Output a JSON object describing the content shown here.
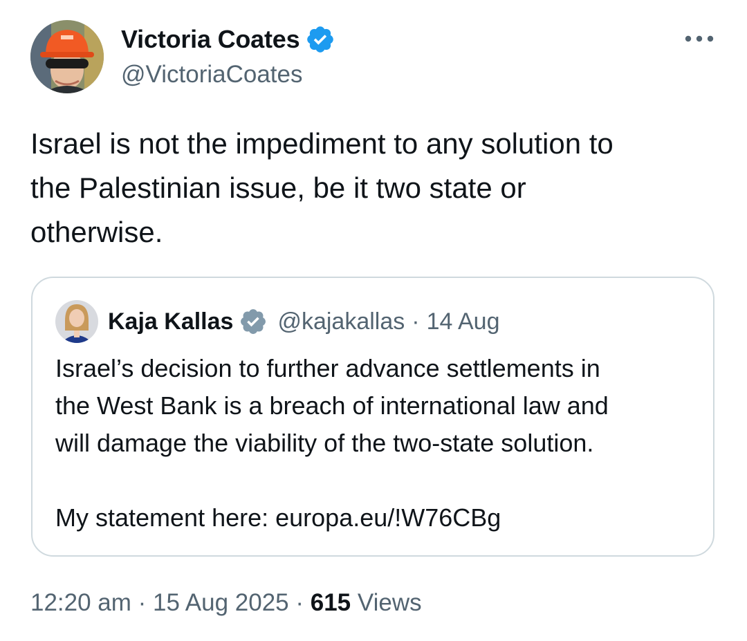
{
  "author": {
    "name": "Victoria Coates",
    "handle": "@VictoriaCoates",
    "avatar_icon": "hardhat-person-avatar",
    "verified_icon": "blue-verified-badge-icon",
    "verified_color": "#1d9bf0"
  },
  "more_icon": "more-horizontal-icon",
  "tweet_text": "Israel is not the impediment to any solution to\nthe Palestinian issue, be it two state or\notherwise.",
  "quoted": {
    "name": "Kaja Kallas",
    "verified_icon": "grey-verified-badge-icon",
    "verified_color": "#829aab",
    "handle": "@kajakallas",
    "separator": "·",
    "date": "14 Aug",
    "text": "Israel’s decision to further advance settlements in\nthe West Bank is a breach of international law and\nwill damage the viability of the two-state solution.\n\nMy statement here: europa.eu/!W76CBg"
  },
  "meta": {
    "time": "12:20 am",
    "sep1": " · ",
    "date": "15 Aug 2025",
    "sep2": " · ",
    "views_count": "615",
    "views_label": " Views"
  },
  "colors": {
    "text_primary": "#0f1419",
    "text_secondary": "#536471",
    "border": "#cfd9de"
  }
}
